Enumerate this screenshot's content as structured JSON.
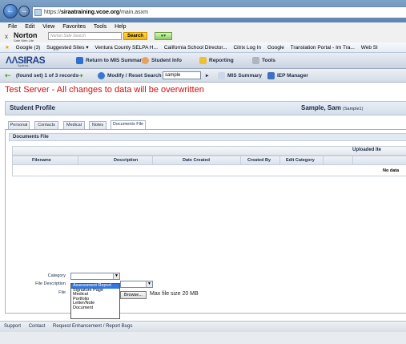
{
  "browser": {
    "url_prefix": "https://",
    "url_host": "siraatraining.vcoe.org",
    "url_path": "/main.asxm",
    "back_glyph": "back-icon",
    "forward_glyph": "forward-icon"
  },
  "menu": [
    "File",
    "Edit",
    "View",
    "Favorites",
    "Tools",
    "Help"
  ],
  "norton": {
    "close": "x",
    "logo": "Norton",
    "sublabel": "Safe Web Lite",
    "search_placeholder": "Norton Safe Search",
    "search_button": "Search"
  },
  "favorites": [
    "Google (3)",
    "Suggested Sites ▾",
    "Ventura County SELPA H...",
    "California School Director...",
    "Citrix Log In",
    "Google",
    "Translation Portal - Im Tra...",
    "Web Sl"
  ],
  "app": {
    "logo": "SIRAS",
    "logo_sub": "Systems",
    "nav": [
      "Return to MIS Summary",
      "Student Info",
      "Reporting",
      "Tools"
    ],
    "record_label": "(found set) 1 of 3 records",
    "modify_label": "Modify / Reset Search",
    "search_value": "sample",
    "mis_summary": "MIS Summary",
    "iep_manager": "IEP Manager"
  },
  "warning": "Test Server - All changes to data will be overwritten",
  "profile": {
    "title": "Student Profile",
    "student_name": "Sample, Sam",
    "student_id": "(Sample1)"
  },
  "tabs": [
    "Personal",
    "Contacts",
    "Medical",
    "Notes",
    "Documents File"
  ],
  "active_tab": "Documents File",
  "documents": {
    "section_title": "Documents File",
    "uploaded_header": "Uploaded Ite",
    "columns": [
      "Filename",
      "Description",
      "Date Created",
      "Created By",
      "Edit Category"
    ],
    "empty_text": "No data"
  },
  "form": {
    "category_label": "Category",
    "category_value": "",
    "description_label": "File Description",
    "file_label": "File",
    "browse_label": "Browse...",
    "max_size": "Max file size 20 MB",
    "category_options": [
      "Assessment Report",
      "Signature Page",
      "Medical",
      "Portfolio",
      "Letter/Note",
      "Document"
    ],
    "highlighted_option": "Assessment Report"
  },
  "footer": [
    "Support",
    "Contact",
    "Request Enhancement / Report Bugs"
  ]
}
